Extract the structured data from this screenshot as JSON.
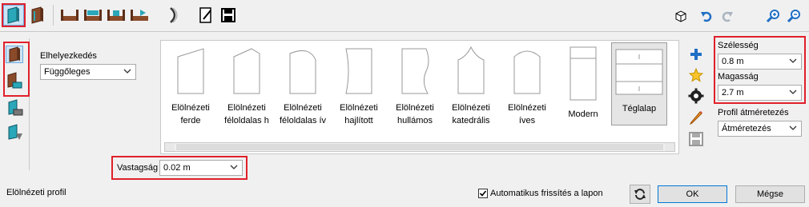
{
  "toolbar": {
    "icons": [
      "panel-icon",
      "panel-alt-icon",
      "shelf-icon",
      "shelf-2-icon",
      "shelf-3-icon",
      "shelf-4-icon",
      "curve-icon",
      "edit-icon",
      "save-icon",
      "box-3d-icon",
      "undo-icon",
      "redo-icon",
      "zoom-in-icon",
      "zoom-out-icon"
    ]
  },
  "placement": {
    "label": "Elhelyezkedés",
    "value": "Függőleges"
  },
  "profiles": [
    {
      "line1": "Elölnézeti",
      "line2": "ferde"
    },
    {
      "line1": "Elölnézeti",
      "line2": "féloldalas h"
    },
    {
      "line1": "Elölnézeti",
      "line2": "féloldalas ív"
    },
    {
      "line1": "Elölnézeti",
      "line2": "hajlított"
    },
    {
      "line1": "Elölnézeti",
      "line2": "hullámos"
    },
    {
      "line1": "Elölnézeti",
      "line2": "katedrális"
    },
    {
      "line1": "Elölnézeti",
      "line2": "íves"
    },
    {
      "line1": "Modern",
      "line2": ""
    },
    {
      "line1": "Téglalap",
      "line2": ""
    }
  ],
  "selected_profile": "Téglalap",
  "thickness": {
    "label": "Vastagság",
    "value": "0.02 m"
  },
  "width": {
    "label": "Szélesség",
    "value": "0.8 m"
  },
  "height": {
    "label": "Magasság",
    "value": "2.7 m"
  },
  "profile_resize": {
    "label": "Profil átméretezés",
    "value": "Átméretezés"
  },
  "footer": {
    "section_label": "Elölnézeti profil",
    "auto_refresh_label": "Automatikus frissítés a lapon",
    "auto_refresh_checked": true,
    "ok_label": "OK",
    "cancel_label": "Mégse"
  },
  "colors": {
    "highlight": "#e0202a",
    "accent_teal": "#2aa7b8",
    "wood": "#8a4b2a",
    "blue": "#1f6fc5"
  }
}
